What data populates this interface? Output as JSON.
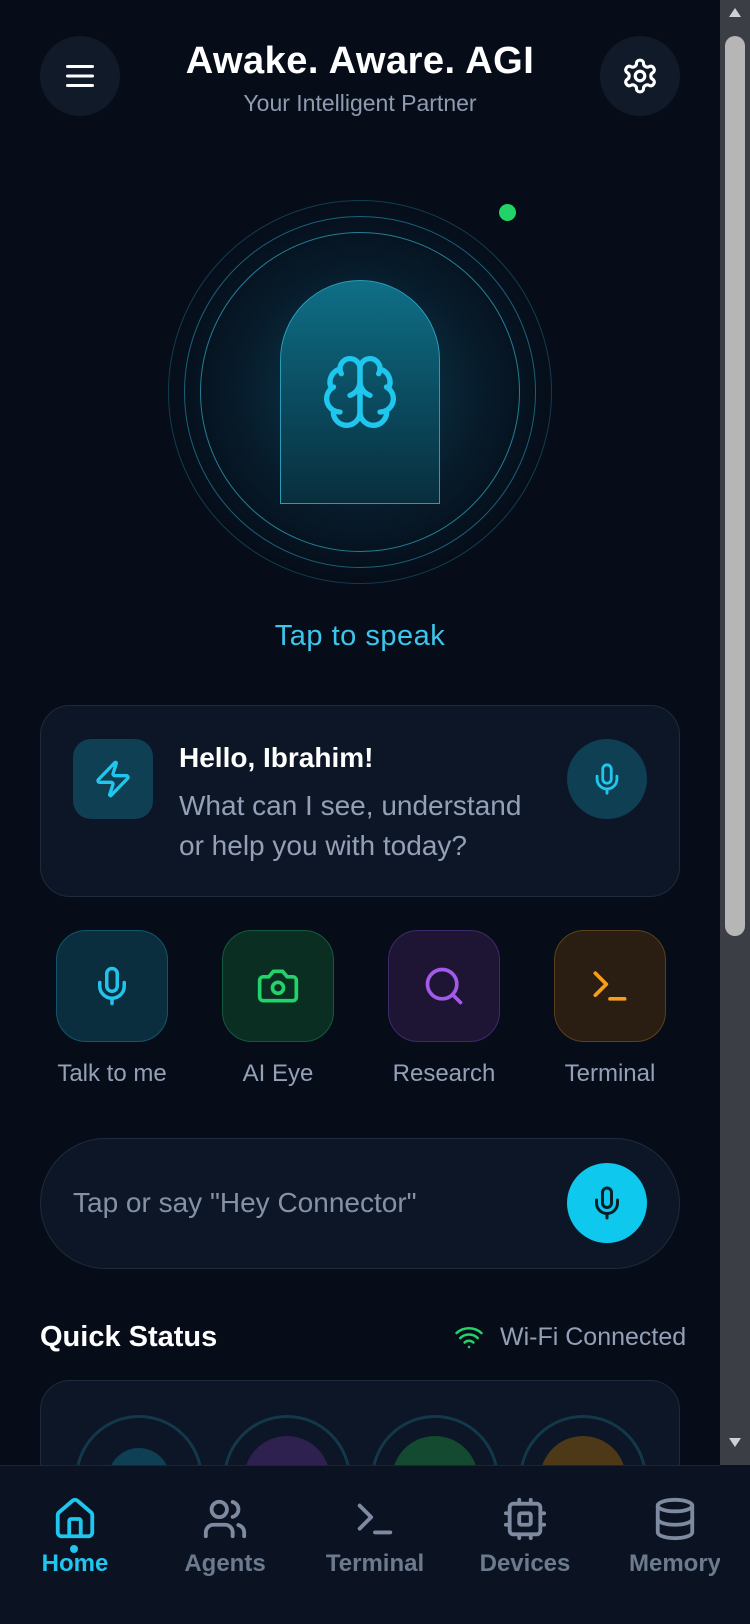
{
  "header": {
    "title": "Awake. Aware. AGI",
    "subtitle": "Your Intelligent Partner",
    "menu_icon": "hamburger-menu-icon",
    "settings_icon": "gear-icon"
  },
  "orb": {
    "icon": "brain-icon",
    "status_indicator": "online",
    "status_color": "#22d36a",
    "tap_label": "Tap to speak"
  },
  "greeting": {
    "icon": "lightning-bolt-icon",
    "title": "Hello, Ibrahim!",
    "body": "What can I see, understand or help you with today?",
    "mic_icon": "microphone-icon"
  },
  "quick_actions": [
    {
      "label": "Talk to me",
      "icon": "microphone-icon",
      "color": "#23c3ea"
    },
    {
      "label": "AI Eye",
      "icon": "camera-icon",
      "color": "#22d36a"
    },
    {
      "label": "Research",
      "icon": "search-icon",
      "color": "#a25ae8"
    },
    {
      "label": "Terminal",
      "icon": "terminal-icon",
      "color": "#f59e1c"
    }
  ],
  "command": {
    "placeholder": "Tap or say \"Hey Connector\"",
    "value": "",
    "mic_icon": "microphone-icon"
  },
  "quick_status": {
    "title": "Quick Status",
    "wifi_label": "Wi-Fi Connected",
    "wifi_icon": "wifi-icon",
    "wifi_color": "#22d36a"
  },
  "nav": {
    "active": "Home",
    "items": [
      {
        "label": "Home",
        "icon": "home-icon"
      },
      {
        "label": "Agents",
        "icon": "users-icon"
      },
      {
        "label": "Terminal",
        "icon": "terminal-icon"
      },
      {
        "label": "Devices",
        "icon": "chip-icon"
      },
      {
        "label": "Memory",
        "icon": "database-icon"
      }
    ]
  },
  "colors": {
    "accent": "#1fc6ee",
    "background": "#060d19",
    "card": "#0c1627"
  }
}
